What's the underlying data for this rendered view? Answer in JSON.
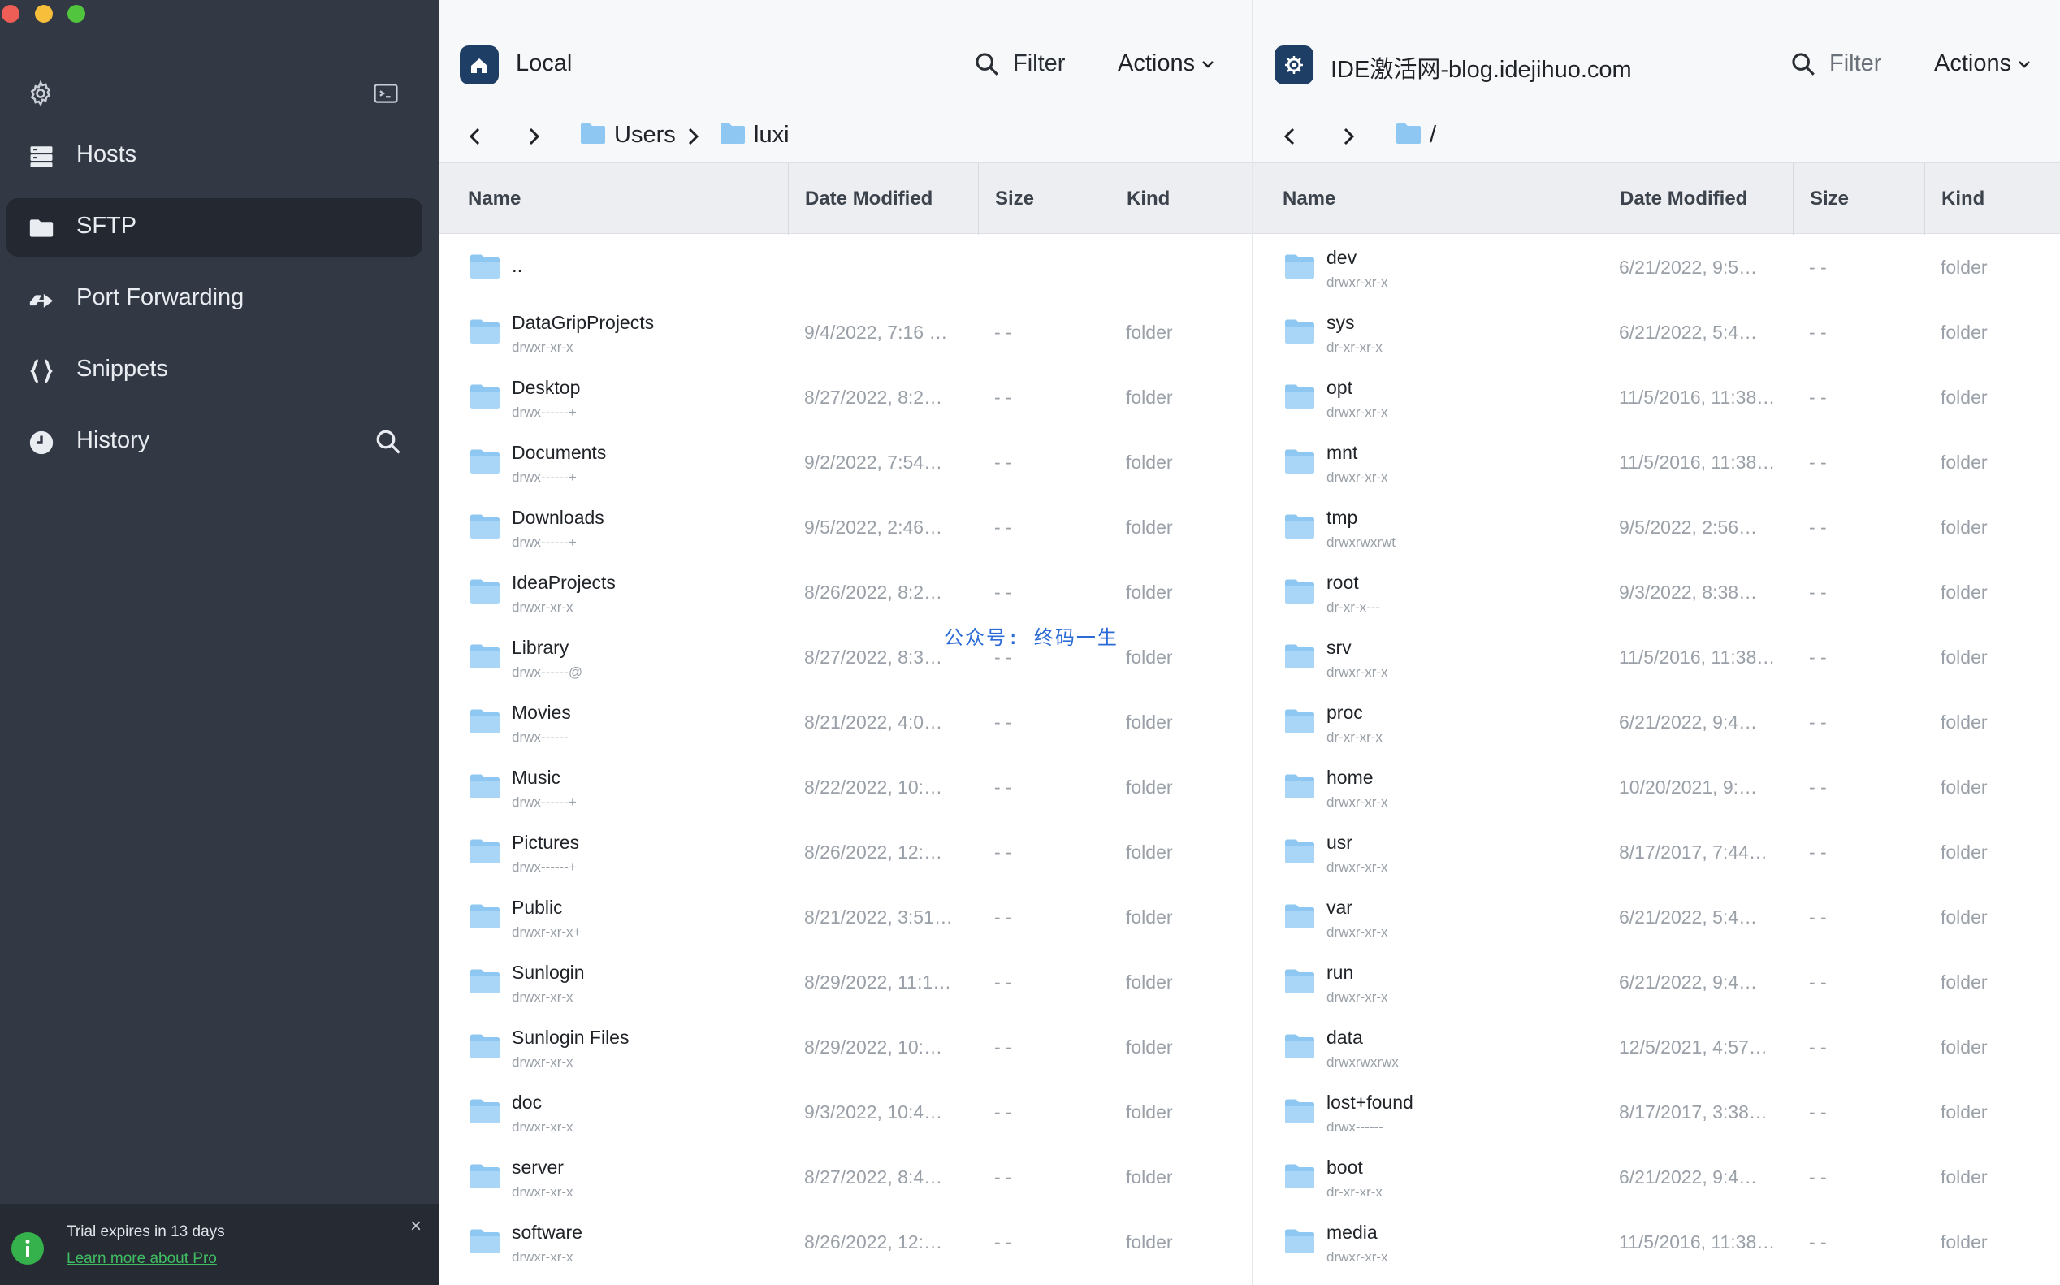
{
  "sidebar": {
    "nav": [
      {
        "label": "Hosts",
        "icon": "hosts-icon",
        "active": false
      },
      {
        "label": "SFTP",
        "icon": "folder-icon",
        "active": true
      },
      {
        "label": "Port Forwarding",
        "icon": "port-forwarding-icon",
        "active": false
      },
      {
        "label": "Snippets",
        "icon": "snippets-icon",
        "active": false
      },
      {
        "label": "History",
        "icon": "history-icon",
        "active": false
      }
    ],
    "trial": {
      "text": "Trial expires in 13 days",
      "link": "Learn more about Pro",
      "close": "×"
    }
  },
  "local": {
    "host": "Local",
    "filter_label": "Filter",
    "actions_label": "Actions",
    "breadcrumb": [
      "Users",
      "luxi"
    ],
    "columns": {
      "name": "Name",
      "date": "Date Modified",
      "size": "Size",
      "kind": "Kind"
    },
    "up_dir": "..",
    "files": [
      {
        "name": "DataGripProjects",
        "perm": "drwxr-xr-x",
        "date": "9/4/2022, 7:16 …",
        "size": "- -",
        "kind": "folder"
      },
      {
        "name": "Desktop",
        "perm": "drwx------+",
        "date": "8/27/2022, 8:2…",
        "size": "- -",
        "kind": "folder"
      },
      {
        "name": "Documents",
        "perm": "drwx------+",
        "date": "9/2/2022, 7:54…",
        "size": "- -",
        "kind": "folder"
      },
      {
        "name": "Downloads",
        "perm": "drwx------+",
        "date": "9/5/2022, 2:46…",
        "size": "- -",
        "kind": "folder"
      },
      {
        "name": "IdeaProjects",
        "perm": "drwxr-xr-x",
        "date": "8/26/2022, 8:2…",
        "size": "- -",
        "kind": "folder"
      },
      {
        "name": "Library",
        "perm": "drwx------@",
        "date": "8/27/2022, 8:3…",
        "size": "- -",
        "kind": "folder"
      },
      {
        "name": "Movies",
        "perm": "drwx------",
        "date": "8/21/2022, 4:0…",
        "size": "- -",
        "kind": "folder"
      },
      {
        "name": "Music",
        "perm": "drwx------+",
        "date": "8/22/2022, 10:…",
        "size": "- -",
        "kind": "folder"
      },
      {
        "name": "Pictures",
        "perm": "drwx------+",
        "date": "8/26/2022, 12:…",
        "size": "- -",
        "kind": "folder"
      },
      {
        "name": "Public",
        "perm": "drwxr-xr-x+",
        "date": "8/21/2022, 3:51…",
        "size": "- -",
        "kind": "folder"
      },
      {
        "name": "Sunlogin",
        "perm": "drwxr-xr-x",
        "date": "8/29/2022, 11:1…",
        "size": "- -",
        "kind": "folder"
      },
      {
        "name": "Sunlogin Files",
        "perm": "drwxr-xr-x",
        "date": "8/29/2022, 10:…",
        "size": "- -",
        "kind": "folder"
      },
      {
        "name": "doc",
        "perm": "drwxr-xr-x",
        "date": "9/3/2022, 10:4…",
        "size": "- -",
        "kind": "folder"
      },
      {
        "name": "server",
        "perm": "drwxr-xr-x",
        "date": "8/27/2022, 8:4…",
        "size": "- -",
        "kind": "folder"
      },
      {
        "name": "software",
        "perm": "drwxr-xr-x",
        "date": "8/26/2022, 12:…",
        "size": "- -",
        "kind": "folder"
      }
    ]
  },
  "remote": {
    "host": "IDE激活网-blog.idejihuo.com",
    "filter_label": "Filter",
    "actions_label": "Actions",
    "breadcrumb": [
      "/"
    ],
    "columns": {
      "name": "Name",
      "date": "Date Modified",
      "size": "Size",
      "kind": "Kind"
    },
    "files": [
      {
        "name": "dev",
        "perm": "drwxr-xr-x",
        "date": "6/21/2022, 9:5…",
        "size": "- -",
        "kind": "folder"
      },
      {
        "name": "sys",
        "perm": "dr-xr-xr-x",
        "date": "6/21/2022, 5:4…",
        "size": "- -",
        "kind": "folder"
      },
      {
        "name": "opt",
        "perm": "drwxr-xr-x",
        "date": "11/5/2016, 11:38…",
        "size": "- -",
        "kind": "folder"
      },
      {
        "name": "mnt",
        "perm": "drwxr-xr-x",
        "date": "11/5/2016, 11:38…",
        "size": "- -",
        "kind": "folder"
      },
      {
        "name": "tmp",
        "perm": "drwxrwxrwt",
        "date": "9/5/2022, 2:56…",
        "size": "- -",
        "kind": "folder"
      },
      {
        "name": "root",
        "perm": "dr-xr-x---",
        "date": "9/3/2022, 8:38…",
        "size": "- -",
        "kind": "folder"
      },
      {
        "name": "srv",
        "perm": "drwxr-xr-x",
        "date": "11/5/2016, 11:38…",
        "size": "- -",
        "kind": "folder"
      },
      {
        "name": "proc",
        "perm": "dr-xr-xr-x",
        "date": "6/21/2022, 9:4…",
        "size": "- -",
        "kind": "folder"
      },
      {
        "name": "home",
        "perm": "drwxr-xr-x",
        "date": "10/20/2021, 9:…",
        "size": "- -",
        "kind": "folder"
      },
      {
        "name": "usr",
        "perm": "drwxr-xr-x",
        "date": "8/17/2017, 7:44…",
        "size": "- -",
        "kind": "folder"
      },
      {
        "name": "var",
        "perm": "drwxr-xr-x",
        "date": "6/21/2022, 5:4…",
        "size": "- -",
        "kind": "folder"
      },
      {
        "name": "run",
        "perm": "drwxr-xr-x",
        "date": "6/21/2022, 9:4…",
        "size": "- -",
        "kind": "folder"
      },
      {
        "name": "data",
        "perm": "drwxrwxrwx",
        "date": "12/5/2021, 4:57…",
        "size": "- -",
        "kind": "folder"
      },
      {
        "name": "lost+found",
        "perm": "drwx------",
        "date": "8/17/2017, 3:38…",
        "size": "- -",
        "kind": "folder"
      },
      {
        "name": "boot",
        "perm": "dr-xr-xr-x",
        "date": "6/21/2022, 9:4…",
        "size": "- -",
        "kind": "folder"
      },
      {
        "name": "media",
        "perm": "drwxr-xr-x",
        "date": "11/5/2016, 11:38…",
        "size": "- -",
        "kind": "folder"
      }
    ]
  },
  "watermark": "公众号: 终码一生",
  "colors": {
    "sidebar_bg": "#323844",
    "sidebar_active": "#232831",
    "folder_blue": "#8ec8f2",
    "host_badge": "#1f3e66",
    "trial_green": "#35b24b"
  }
}
